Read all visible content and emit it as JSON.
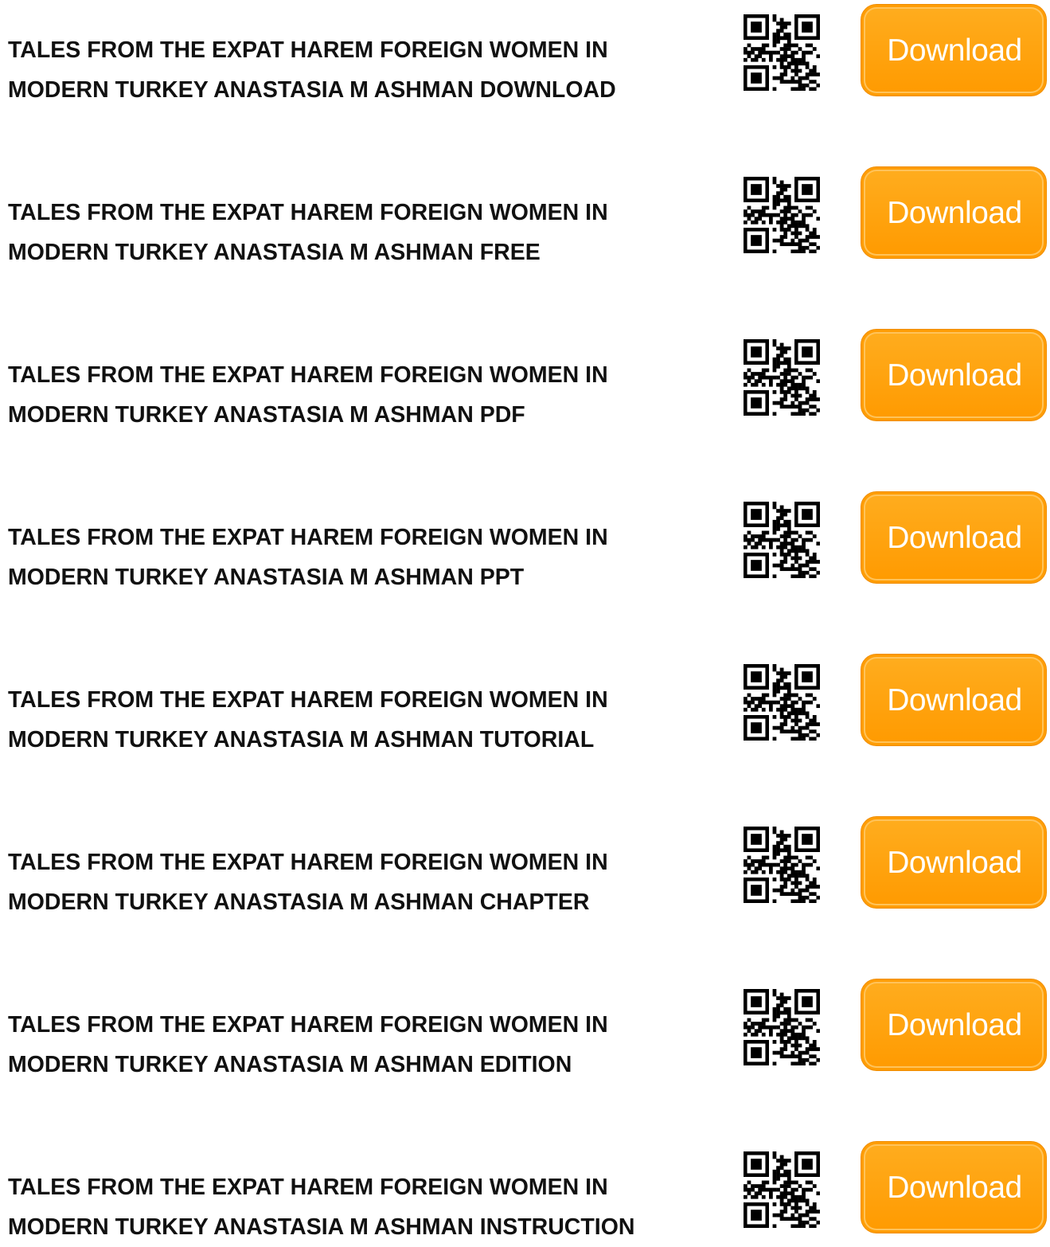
{
  "entries": [
    {
      "title_line1": "TALES FROM THE EXPAT HAREM FOREIGN WOMEN IN",
      "title_line2": "MODERN TURKEY ANASTASIA M ASHMAN DOWNLOAD",
      "button_label": "Download"
    },
    {
      "title_line1": "TALES FROM THE EXPAT HAREM FOREIGN WOMEN IN",
      "title_line2": "MODERN TURKEY ANASTASIA M ASHMAN FREE",
      "button_label": "Download"
    },
    {
      "title_line1": "TALES FROM THE EXPAT HAREM FOREIGN WOMEN IN",
      "title_line2": "MODERN TURKEY ANASTASIA M ASHMAN PDF",
      "button_label": "Download"
    },
    {
      "title_line1": "TALES FROM THE EXPAT HAREM FOREIGN WOMEN IN",
      "title_line2": "MODERN TURKEY ANASTASIA M ASHMAN PPT",
      "button_label": "Download"
    },
    {
      "title_line1": "TALES FROM THE EXPAT HAREM FOREIGN WOMEN IN",
      "title_line2": "MODERN TURKEY ANASTASIA M ASHMAN TUTORIAL",
      "button_label": "Download"
    },
    {
      "title_line1": "TALES FROM THE EXPAT HAREM FOREIGN WOMEN IN",
      "title_line2": "MODERN TURKEY ANASTASIA M ASHMAN CHAPTER",
      "button_label": "Download"
    },
    {
      "title_line1": "TALES FROM THE EXPAT HAREM FOREIGN WOMEN IN",
      "title_line2": "MODERN TURKEY ANASTASIA M ASHMAN EDITION",
      "button_label": "Download"
    },
    {
      "title_line1": "TALES FROM THE EXPAT HAREM FOREIGN WOMEN IN",
      "title_line2": "MODERN TURKEY ANASTASIA M ASHMAN INSTRUCTION",
      "button_label": "Download"
    }
  ],
  "colors": {
    "button_fill": "#ff9f0a",
    "button_text": "#ffffff",
    "title_text": "#111111",
    "qr_dark": "#000000"
  },
  "icons": {
    "qr": "qr-code-icon"
  }
}
